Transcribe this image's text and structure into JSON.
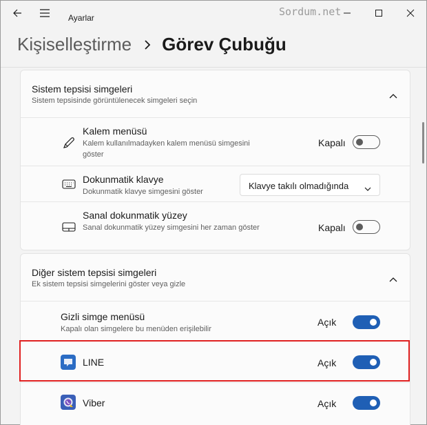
{
  "window": {
    "app_title": "Ayarlar",
    "watermark": "Sordum.net"
  },
  "header": {
    "parent": "Kişiselleştirme",
    "current": "Görev Çubuğu"
  },
  "system_tray": {
    "title": "Sistem tepsisi simgeleri",
    "description": "Sistem tepsisinde görüntülenecek simgeleri seçin",
    "items": [
      {
        "title": "Kalem menüsü",
        "description": "Kalem kullanılmadayken kalem menüsü simgesini göster",
        "state_label": "Kapalı",
        "on": false,
        "icon": "pen-icon"
      },
      {
        "title": "Dokunmatik klavye",
        "description": "Dokunmatik klavye simgesini göster",
        "dropdown_value": "Klavye takılı olmadığında",
        "icon": "keyboard-icon"
      },
      {
        "title": "Sanal dokunmatik yüzey",
        "description": "Sanal dokunmatik yüzey simgesini her zaman göster",
        "state_label": "Kapalı",
        "on": false,
        "icon": "touchpad-icon"
      }
    ]
  },
  "other_tray": {
    "title": "Diğer sistem tepsisi simgeleri",
    "description": "Ek sistem tepsisi simgelerini göster veya gizle",
    "items": [
      {
        "title": "Gizli simge menüsü",
        "description": "Kapalı olan simgelere bu menüden erişilebilir",
        "state_label": "Açık",
        "on": true
      },
      {
        "title": "LINE",
        "state_label": "Açık",
        "on": true,
        "icon": "line-app-icon",
        "color": "#2b6cc4"
      },
      {
        "title": "Viber",
        "state_label": "Açık",
        "on": true,
        "icon": "viber-app-icon",
        "color": "#3a5fb8"
      }
    ]
  },
  "colors": {
    "accent": "#1f5fb5",
    "highlight": "#e02020"
  }
}
